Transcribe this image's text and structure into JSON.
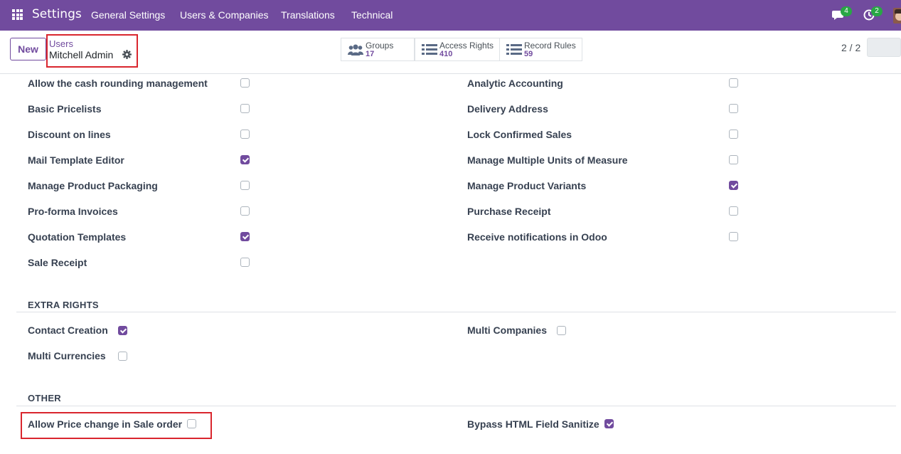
{
  "navbar": {
    "brand": "Settings",
    "menu": [
      "General Settings",
      "Users & Companies",
      "Translations",
      "Technical"
    ],
    "messages_count": "4",
    "activities_count": "2"
  },
  "control": {
    "new_label": "New",
    "breadcrumb_parent": "Users",
    "breadcrumb_current": "Mitchell Admin",
    "smart_buttons": [
      {
        "label": "Groups",
        "count": "17",
        "icon": "users-icon"
      },
      {
        "label": "Access Rights",
        "count": "410",
        "icon": "list-icon"
      },
      {
        "label": "Record Rules",
        "count": "59",
        "icon": "list-icon"
      }
    ],
    "pager": "2 / 2"
  },
  "rights_left": [
    {
      "label": "Allow the cash rounding management",
      "checked": false
    },
    {
      "label": "Basic Pricelists",
      "checked": false
    },
    {
      "label": "Discount on lines",
      "checked": false
    },
    {
      "label": "Mail Template Editor",
      "checked": true
    },
    {
      "label": "Manage Product Packaging",
      "checked": false
    },
    {
      "label": "Pro-forma Invoices",
      "checked": false
    },
    {
      "label": "Quotation Templates",
      "checked": true
    },
    {
      "label": "Sale Receipt",
      "checked": false
    }
  ],
  "rights_right": [
    {
      "label": "Analytic Accounting",
      "checked": false
    },
    {
      "label": "Delivery Address",
      "checked": false
    },
    {
      "label": "Lock Confirmed Sales",
      "checked": false
    },
    {
      "label": "Manage Multiple Units of Measure",
      "checked": false
    },
    {
      "label": "Manage Product Variants",
      "checked": true
    },
    {
      "label": "Purchase Receipt",
      "checked": false
    },
    {
      "label": "Receive notifications in Odoo",
      "checked": false
    }
  ],
  "extra_rights": {
    "title": "EXTRA RIGHTS",
    "items": [
      {
        "label": "Contact Creation",
        "checked": true
      },
      {
        "label": "Multi Companies",
        "checked": false
      },
      {
        "label": "Multi Currencies",
        "checked": false
      }
    ]
  },
  "other": {
    "title": "OTHER",
    "items": [
      {
        "label": "Allow Price change in Sale order",
        "checked": false
      },
      {
        "label": "Bypass HTML Field Sanitize",
        "checked": true
      }
    ]
  },
  "colors": {
    "brand": "#714b9e",
    "highlight": "#d9262e",
    "badge": "#28a745"
  }
}
